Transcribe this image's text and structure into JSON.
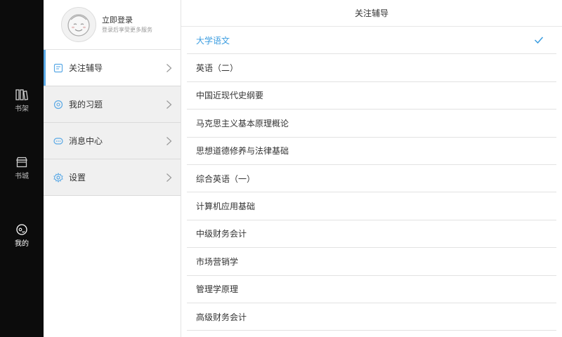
{
  "rail": {
    "items": [
      {
        "label": "书架",
        "icon": "bookshelf-icon"
      },
      {
        "label": "书城",
        "icon": "store-icon"
      },
      {
        "label": "我的",
        "icon": "profile-icon"
      }
    ],
    "active_index": 2
  },
  "profile": {
    "title": "立即登录",
    "subtitle": "登录后享受更多服务"
  },
  "menu": {
    "items": [
      {
        "label": "关注辅导",
        "icon": "note-icon"
      },
      {
        "label": "我的习题",
        "icon": "eye-icon"
      },
      {
        "label": "消息中心",
        "icon": "chat-icon"
      },
      {
        "label": "设置",
        "icon": "gear-icon"
      }
    ]
  },
  "content": {
    "title": "关注辅导",
    "subjects": [
      "大学语文",
      "英语（二）",
      "中国近现代史纲要",
      "马克思主义基本原理概论",
      "思想道德修养与法律基础",
      "综合英语（一）",
      "计算机应用基础",
      "中级财务会计",
      "市场营销学",
      "管理学原理",
      "高级财务会计"
    ],
    "selected_index": 0
  },
  "colors": {
    "accent": "#3b9de0",
    "rail_bg": "#0c0c0c",
    "menu_bg": "#f0f0f0"
  }
}
